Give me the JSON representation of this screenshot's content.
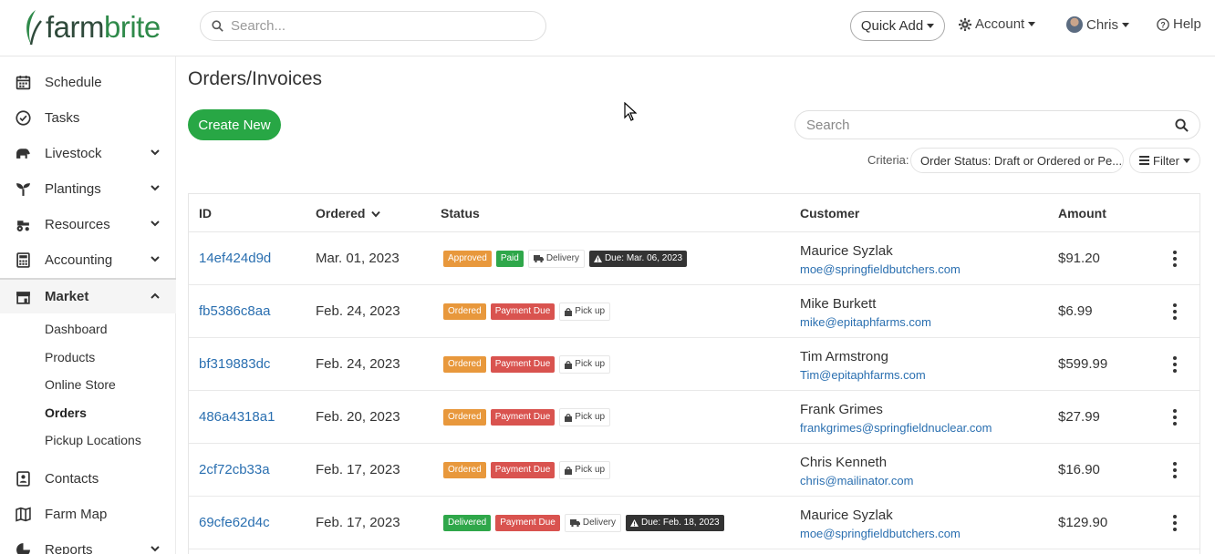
{
  "header": {
    "logo_part1": "farm",
    "logo_part2": "brite",
    "search_placeholder": "Search...",
    "quick_add": "Quick Add",
    "account": "Account",
    "user": "Chris",
    "help": "Help"
  },
  "sidebar": {
    "items": [
      {
        "label": "Schedule",
        "icon": "calendar-icon"
      },
      {
        "label": "Tasks",
        "icon": "check-circle-icon"
      },
      {
        "label": "Livestock",
        "icon": "cow-icon"
      },
      {
        "label": "Plantings",
        "icon": "seedling-icon"
      },
      {
        "label": "Resources",
        "icon": "tractor-icon"
      },
      {
        "label": "Accounting",
        "icon": "calculator-icon"
      },
      {
        "label": "Market",
        "icon": "store-icon"
      },
      {
        "label": "Contacts",
        "icon": "address-book-icon"
      },
      {
        "label": "Farm Map",
        "icon": "map-icon"
      },
      {
        "label": "Reports",
        "icon": "chart-pie-icon"
      }
    ],
    "market_sub": [
      "Dashboard",
      "Products",
      "Online Store",
      "Orders",
      "Pickup Locations"
    ]
  },
  "main": {
    "title": "Orders/Invoices",
    "create_new": "Create New",
    "search_placeholder": "Search",
    "criteria_label": "Criteria:",
    "criteria_value": "Order Status: Draft or Ordered or Pe...",
    "filter": "Filter"
  },
  "table": {
    "headers": [
      "ID",
      "Ordered",
      "Status",
      "Customer",
      "Amount"
    ],
    "rows": [
      {
        "id": "14ef424d9d",
        "date": "Mar. 01, 2023",
        "status": "Approved",
        "payment": "Paid",
        "method": "Delivery",
        "due": "Due: Mar. 06, 2023",
        "name": "Maurice Syzlak",
        "email": "moe@springfieldbutchers.com",
        "amount": "$91.20"
      },
      {
        "id": "fb5386c8aa",
        "date": "Feb. 24, 2023",
        "status": "Ordered",
        "payment": "Payment Due",
        "method": "Pick up",
        "due": "",
        "name": "Mike Burkett",
        "email": "mike@epitaphfarms.com",
        "amount": "$6.99"
      },
      {
        "id": "bf319883dc",
        "date": "Feb. 24, 2023",
        "status": "Ordered",
        "payment": "Payment Due",
        "method": "Pick up",
        "due": "",
        "name": "Tim Armstrong",
        "email": "Tim@epitaphfarms.com",
        "amount": "$599.99"
      },
      {
        "id": "486a4318a1",
        "date": "Feb. 20, 2023",
        "status": "Ordered",
        "payment": "Payment Due",
        "method": "Pick up",
        "due": "",
        "name": "Frank Grimes",
        "email": "frankgrimes@springfieldnuclear.com",
        "amount": "$27.99"
      },
      {
        "id": "2cf72cb33a",
        "date": "Feb. 17, 2023",
        "status": "Ordered",
        "payment": "Payment Due",
        "method": "Pick up",
        "due": "",
        "name": "Chris Kenneth",
        "email": "chris@mailinator.com",
        "amount": "$16.90"
      },
      {
        "id": "69cfe62d4c",
        "date": "Feb. 17, 2023",
        "status": "Delivered",
        "payment": "Payment Due",
        "method": "Delivery",
        "due": "Due: Feb. 18, 2023",
        "name": "Maurice Syzlak",
        "email": "moe@springfieldbutchers.com",
        "amount": "$129.90"
      }
    ]
  },
  "colors": {
    "brand_green": "#28a745",
    "link_blue": "#2a6fb0",
    "orange": "#e8983c",
    "red": "#d9534f",
    "dark": "#333333"
  }
}
